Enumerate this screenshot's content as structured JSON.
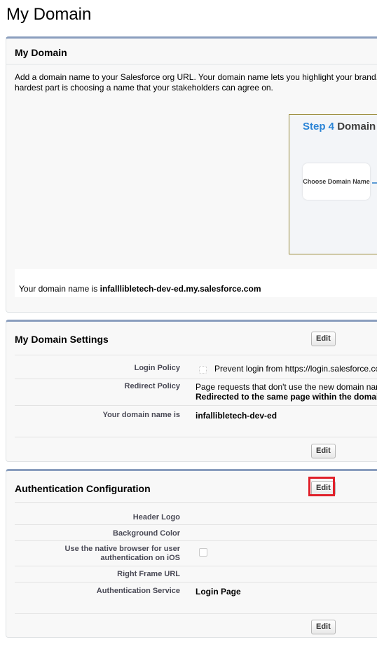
{
  "page": {
    "title": "My Domain"
  },
  "my_domain": {
    "title": "My Domain",
    "description": "Add a domain name to your Salesforce org URL. Your domain name lets you highlight your brand. The hardest part is choosing a name that your stakeholders can agree on.",
    "promo": {
      "step": "Step 4",
      "step_rest": "Domain",
      "card_label": "Choose Domain Name"
    },
    "domain_name_prefix": "Your domain name is ",
    "domain_name": "infalllibletech-dev-ed.my.salesforce.com"
  },
  "settings": {
    "title": "My Domain Settings",
    "edit_label": "Edit",
    "login_policy": {
      "label": "Login Policy",
      "value": "Prevent login from https://login.salesforce.com"
    },
    "redirect_policy": {
      "label": "Redirect Policy",
      "line1": "Page requests that don't use the new domain name",
      "line2": "Redirected to the same page within the domain"
    },
    "domain_name": {
      "label": "Your domain name is",
      "value": "infallibletech-dev-ed"
    },
    "edit_bottom_label": "Edit"
  },
  "auth": {
    "title": "Authentication Configuration",
    "edit_label": "Edit",
    "header_logo": {
      "label": "Header Logo"
    },
    "background_color": {
      "label": "Background Color"
    },
    "native_browser": {
      "label": "Use the native browser for user authentication on iOS"
    },
    "right_frame": {
      "label": "Right Frame URL"
    },
    "auth_service": {
      "label": "Authentication Service",
      "value": "Login Page"
    },
    "edit_bottom_label": "Edit"
  },
  "colors": {
    "panel_border": "#8a9ebe",
    "highlight": "#e0202a",
    "promo_blue": "#2b84d6"
  }
}
